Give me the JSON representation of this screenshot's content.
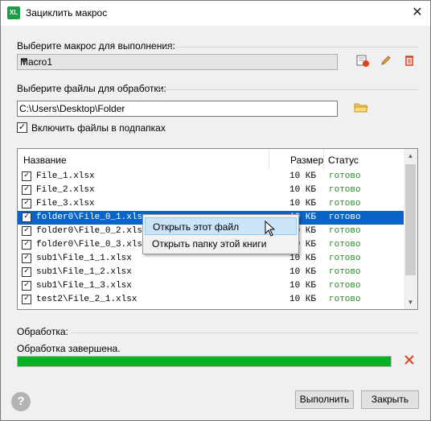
{
  "window": {
    "title": "Зациклить макрос",
    "app_icon": "XL",
    "close": "✕"
  },
  "macro": {
    "label": "Выберите макрос для выполнения:",
    "selected": "Macro1",
    "icons": [
      "run-icon",
      "edit-icon",
      "delete-icon"
    ]
  },
  "files": {
    "label": "Выберите файлы для обработки:",
    "folder": "C:\\Users\\Desktop\\Folder",
    "include_subfolders_label": "Включить файлы в подпапках",
    "include_subfolders": true
  },
  "list": {
    "columns": [
      "Название",
      "Размер",
      "Статус"
    ],
    "rows": [
      {
        "name": "File_1.xlsx",
        "size": "10 КБ",
        "status": "готово",
        "checked": true
      },
      {
        "name": "File_2.xlsx",
        "size": "10 КБ",
        "status": "готово",
        "checked": true
      },
      {
        "name": "File_3.xlsx",
        "size": "10 КБ",
        "status": "готово",
        "checked": true
      },
      {
        "name": "folder0\\File_0_1.xlsx",
        "size": "10 КБ",
        "status": "готово",
        "checked": true,
        "selected": true
      },
      {
        "name": "folder0\\File_0_2.xlsx",
        "size": "10 КБ",
        "status": "готово",
        "checked": true
      },
      {
        "name": "folder0\\File_0_3.xlsx",
        "size": "10 КБ",
        "status": "готово",
        "checked": true
      },
      {
        "name": "sub1\\File_1_1.xlsx",
        "size": "10 КБ",
        "status": "готово",
        "checked": true
      },
      {
        "name": "sub1\\File_1_2.xlsx",
        "size": "10 КБ",
        "status": "готово",
        "checked": true
      },
      {
        "name": "sub1\\File_1_3.xlsx",
        "size": "10 КБ",
        "status": "готово",
        "checked": true
      },
      {
        "name": "test2\\File_2_1.xlsx",
        "size": "10 КБ",
        "status": "готово",
        "checked": true
      }
    ]
  },
  "context_menu": {
    "items": [
      "Открыть этот файл",
      "Открыть папку этой книги"
    ]
  },
  "processing": {
    "label": "Обработка:",
    "status": "Обработка завершена.",
    "progress": 1.0
  },
  "buttons": {
    "run": "Выполнить",
    "close": "Закрыть",
    "help": "?"
  },
  "colors": {
    "accent": "#0a64c8",
    "status_ok": "#2a8a2a",
    "progress": "#06b025",
    "cancel": "#e0401a"
  }
}
